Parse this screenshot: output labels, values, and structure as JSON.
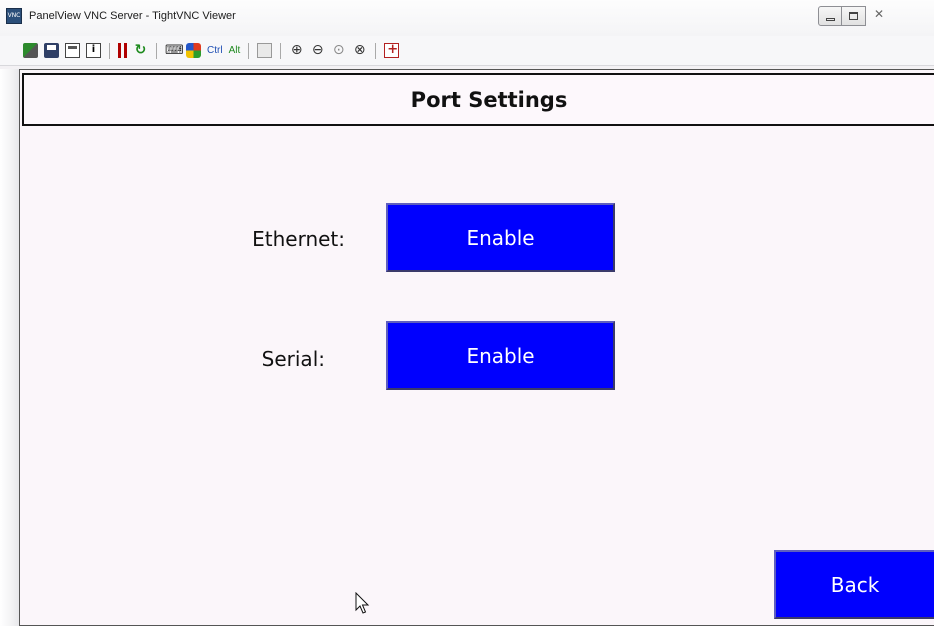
{
  "window": {
    "title": "PanelView VNC Server - TightVNC Viewer",
    "app_icon": "vnc-app-icon",
    "controls": [
      "minimize",
      "maximize",
      "close"
    ]
  },
  "toolbar": {
    "ctrl_label": "Ctrl",
    "alt_label": "Alt",
    "ctrl_color": "#1f4fb4",
    "alt_color": "#1f8a1f"
  },
  "screen": {
    "title": "Port Settings",
    "rows": [
      {
        "label": "Ethernet:",
        "button": "Enable"
      },
      {
        "label": "Serial:",
        "button": "Enable"
      }
    ],
    "back_button": "Back",
    "button_color": "#0000fe"
  }
}
